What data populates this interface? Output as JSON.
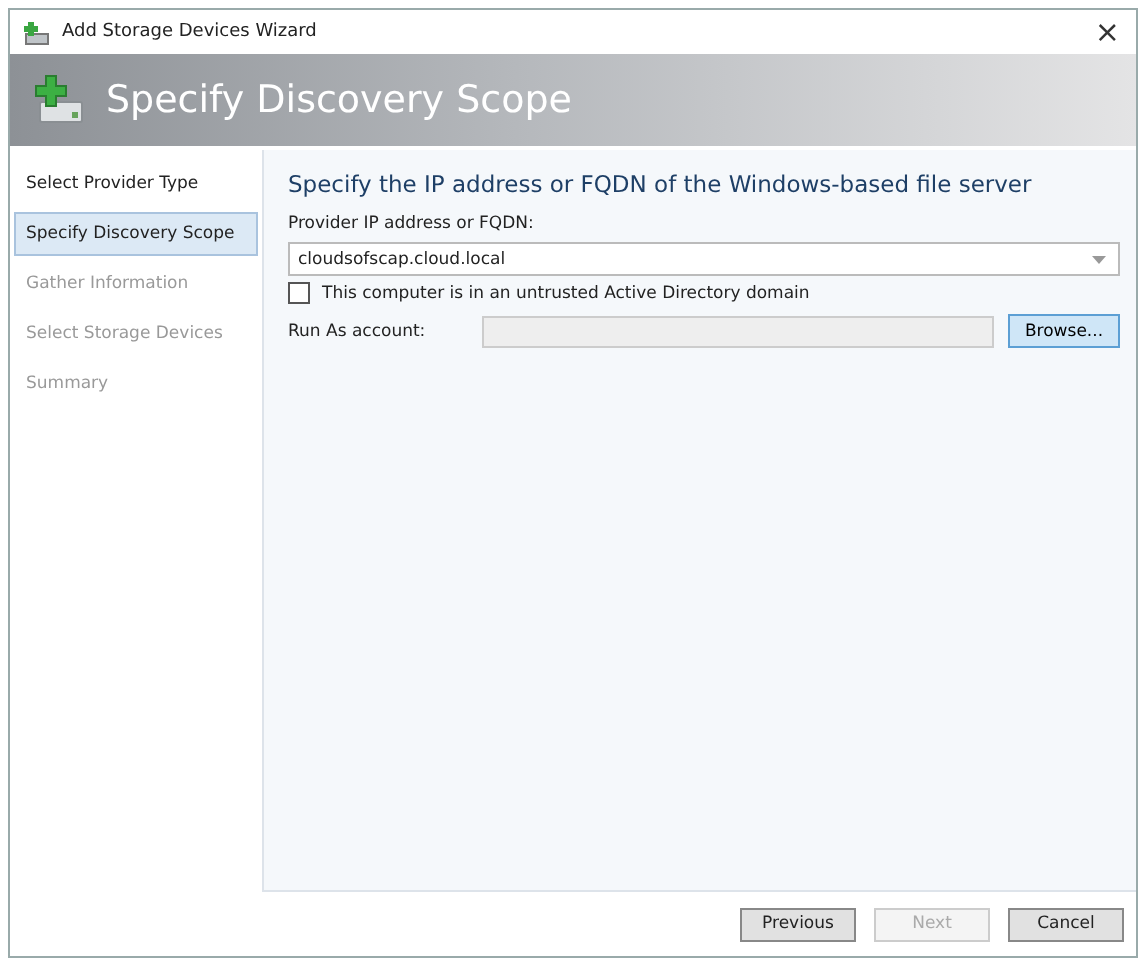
{
  "window": {
    "title": "Add Storage Devices Wizard",
    "close": "×"
  },
  "header": {
    "title": "Specify Discovery Scope"
  },
  "steps": [
    {
      "label": "Select Provider Type",
      "selected": false,
      "disabled": false
    },
    {
      "label": "Specify Discovery Scope",
      "selected": true,
      "disabled": false
    },
    {
      "label": "Gather Information",
      "selected": false,
      "disabled": true
    },
    {
      "label": "Select Storage Devices",
      "selected": false,
      "disabled": true
    },
    {
      "label": "Summary",
      "selected": false,
      "disabled": true
    }
  ],
  "content": {
    "heading": "Specify the IP address or FQDN of the Windows-based file server",
    "provider_label": "Provider IP address or FQDN:",
    "provider_value": "cloudsofscap.cloud.local",
    "untrusted": {
      "label": "This computer is in an untrusted Active Directory domain",
      "checked": false
    },
    "run_as_label": "Run As account:",
    "browse_button": "Browse..."
  },
  "buttons": [
    {
      "label": "Previous",
      "disabled": false
    },
    {
      "label": "Next",
      "disabled": true
    },
    {
      "label": "Cancel",
      "disabled": false
    }
  ]
}
